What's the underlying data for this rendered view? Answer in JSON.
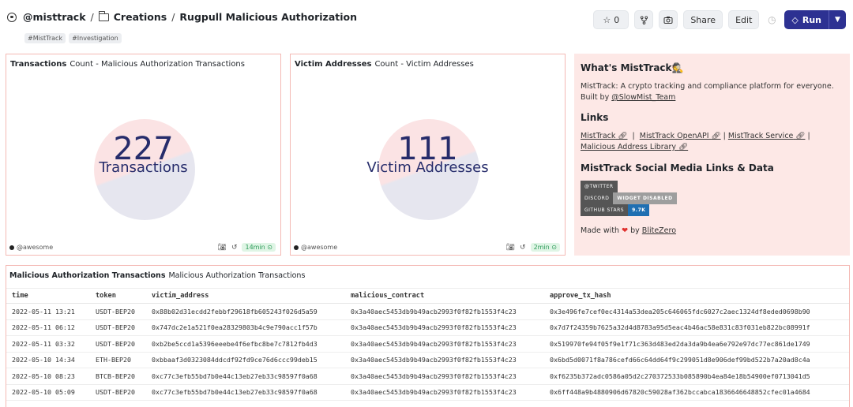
{
  "header": {
    "owner": "@misttrack",
    "folder": "Creations",
    "title": "Rugpull Malicious Authorization",
    "tags": [
      "#MistTrack",
      "#Investigation"
    ],
    "star_count": "0",
    "share_label": "Share",
    "edit_label": "Edit",
    "run_label": "Run"
  },
  "card_transactions": {
    "title": "Transactions",
    "subtitle": "Count - Malicious Authorization Transactions",
    "value": "227",
    "label": "Transactions",
    "author": "@awesome",
    "freshness": "14min"
  },
  "card_victims": {
    "title": "Victim Addresses",
    "subtitle": "Count - Victim Addresses",
    "value": "111",
    "label": "Victim Addresses",
    "author": "@awesome",
    "freshness": "2min"
  },
  "text_card": {
    "h1": "What's MistTrack",
    "h1_emoji": "🕵",
    "p1": "MistTrack: A crypto tracking and compliance platform for everyone. Built by",
    "p1_link": "@SlowMist_Team",
    "h2": "Links",
    "links": [
      "MistTrack",
      "MistTrack OpenAPI",
      "MistTrack Service",
      "Malicious Address Library"
    ],
    "h3": "MistTrack Social Media Links & Data",
    "badges": [
      {
        "left": "@TWITTER",
        "right": "",
        "color": ""
      },
      {
        "left": "DISCORD",
        "right": "WIDGET DISABLED",
        "color": "#9e9e9e"
      },
      {
        "left": "GITHUB STARS",
        "right": "9.7K",
        "color": "#1f6fb2"
      }
    ],
    "made_with": "Made with",
    "made_by": "by",
    "made_link": "BliteZero"
  },
  "table": {
    "title": "Malicious Authorization Transactions",
    "subtitle": "Malicious Authorization Transactions",
    "columns": [
      "time",
      "token",
      "victim_address",
      "malicious_contract",
      "approve_tx_hash"
    ],
    "rows": [
      [
        "2022-05-11 13:21",
        "USDT-BEP20",
        "0x88b02d31ecdd2febbf29618fb605243f026d5a59",
        "0x3a40aec5453db9b49acb2993f0f82fb1553f4c23",
        "0x3e496fe7cef0ec4314a53dea205c646065fdc6027c2aec1324df8eded0698b90"
      ],
      [
        "2022-05-11 06:12",
        "USDT-BEP20",
        "0x747dc2e1a521f0ea28329803b4c9e790acc1f57b",
        "0x3a40aec5453db9b49acb2993f0f82fb1553f4c23",
        "0x7d7f24359b7625a32d4d8783a95d5eac4b46ac58e831c83f031eb822bc08991f"
      ],
      [
        "2022-05-11 03:32",
        "USDT-BEP20",
        "0xb2be5ccd1a5396eeebe4f6efbc8be7c7812fb4d3",
        "0x3a40aec5453db9b49acb2993f0f82fb1553f4c23",
        "0x519970fe94f05f9e1f71c363d483ed2da3da9b4ea6e792e97dc77ec861de1749"
      ],
      [
        "2022-05-10 14:34",
        "ETH-BEP20",
        "0xbbaaf3d0323084ddcdf92fd9ce76d6ccc99deb15",
        "0x3a40aec5453db9b49acb2993f0f82fb1553f4c23",
        "0x6bd5d0071f8a786cefd66c64dd64f9c299051d8e906def99bd522b7a20ad8c4a"
      ],
      [
        "2022-05-10 08:23",
        "BTCB-BEP20",
        "0xc77c3efb55bd7b0e44c13eb27eb33c98597f0a68",
        "0x3a40aec5453db9b49acb2993f0f82fb1553f4c23",
        "0xf6235b372adc0586a05d2c270372533b085890b4ea84e18b54900ef0713041d5"
      ],
      [
        "2022-05-10 05:09",
        "USDT-BEP20",
        "0xc77c3efb55bd7b0e44c13eb27eb33c98597f0a68",
        "0x3a40aec5453db9b49acb2993f0f82fb1553f4c23",
        "0x6ff448a9b4880906d67820c59028af362bccabca1836646648852cfec01a4684"
      ]
    ]
  }
}
